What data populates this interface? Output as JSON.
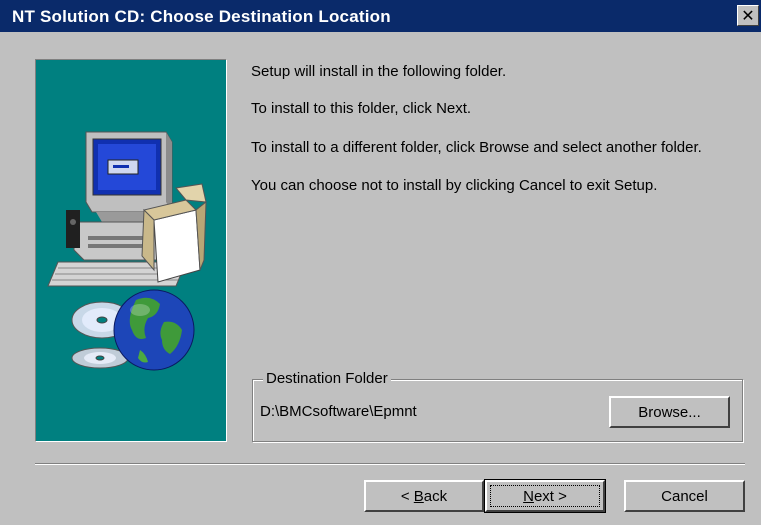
{
  "window": {
    "title": "NT Solution CD: Choose Destination Location",
    "close_glyph": "✕"
  },
  "messages": [
    "Setup will install  in the following folder.",
    "To install to this folder, click Next.",
    "To install to a different folder, click Browse and select another folder.",
    "You can choose not to install  by clicking Cancel to exit Setup."
  ],
  "destination": {
    "group_label": "Destination Folder",
    "path": "D:\\BMCsoftware\\Epmnt",
    "browse_label": "Browse..."
  },
  "buttons": {
    "back_prefix": "< ",
    "back_mnemonic": "B",
    "back_rest": "ack",
    "next_mnemonic": "N",
    "next_rest": "ext >",
    "cancel_label": "Cancel"
  },
  "side_panel": {
    "background": "#008080",
    "icons": [
      "computer-icon",
      "open-box-icon",
      "cd-disc-icon",
      "globe-icon"
    ]
  },
  "colors": {
    "titlebar": "#0a2a6a",
    "face": "#c0c0c0"
  }
}
